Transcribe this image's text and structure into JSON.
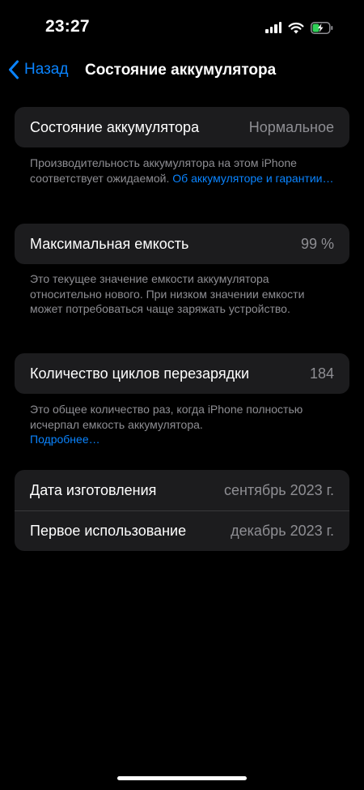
{
  "status": {
    "time": "23:27",
    "battery_color": "#30d158"
  },
  "nav": {
    "back_label": "Назад",
    "title": "Состояние аккумулятора"
  },
  "health": {
    "label": "Состояние аккумулятора",
    "value": "Нормальное",
    "note": "Производительность аккумулятора на этом iPhone соответствует ожидаемой.",
    "link": "Об аккумуляторе и гарантии…"
  },
  "capacity": {
    "label": "Максимальная емкость",
    "value": "99 %",
    "level": 0.99,
    "note": "Это текущее значение емкости аккумулятора относительно нового. При низком значении емкости может потребоваться чаще заряжать устройство."
  },
  "cycles": {
    "label": "Количество циклов перезарядки",
    "value": "184",
    "note": "Это общее количество раз, когда iPhone полностью исчерпал емкость аккумулятора.",
    "link": "Подробнее…"
  },
  "dates": {
    "manufactured_label": "Дата изготовления",
    "manufactured_value": "сентябрь 2023 г.",
    "first_use_label": "Первое использование",
    "first_use_value": "декабрь 2023 г."
  },
  "colors": {
    "accent": "#0a84ff",
    "card": "#1c1c1e",
    "secondary_text": "#8e8e93"
  }
}
